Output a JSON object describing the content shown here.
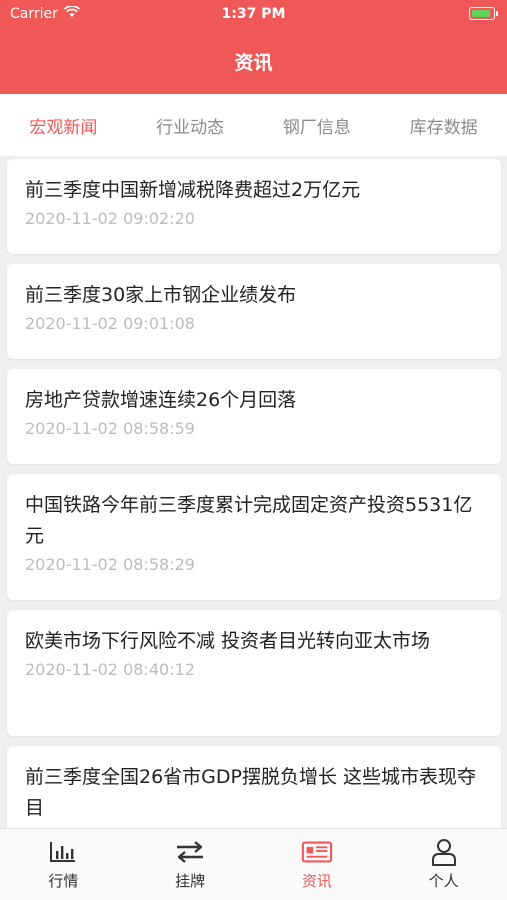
{
  "status": {
    "carrier": "Carrier",
    "time": "1:37 PM"
  },
  "header": {
    "title": "资讯"
  },
  "tabs": [
    {
      "label": "宏观新闻",
      "active": true
    },
    {
      "label": "行业动态",
      "active": false
    },
    {
      "label": "钢厂信息",
      "active": false
    },
    {
      "label": "库存数据",
      "active": false
    }
  ],
  "news": [
    {
      "title": "前三季度中国新增减税降费超过2万亿元",
      "time": "2020-11-02 09:02:20"
    },
    {
      "title": "前三季度30家上市钢企业绩发布",
      "time": "2020-11-02 09:01:08"
    },
    {
      "title": "房地产贷款增速连续26个月回落",
      "time": "2020-11-02 08:58:59"
    },
    {
      "title": "中国铁路今年前三季度累计完成固定资产投资5531亿元",
      "time": "2020-11-02 08:58:29"
    },
    {
      "title": "欧美市场下行风险不减 投资者目光转向亚太市场",
      "time": "2020-11-02 08:40:12"
    },
    {
      "title": "前三季度全国26省市GDP摆脱负增长 这些城市表现夺目",
      "time": ""
    }
  ],
  "tabbar": [
    {
      "label": "行情",
      "icon": "chart-icon",
      "active": false
    },
    {
      "label": "挂牌",
      "icon": "swap-icon",
      "active": false
    },
    {
      "label": "资讯",
      "icon": "newspaper-icon",
      "active": true
    },
    {
      "label": "个人",
      "icon": "person-icon",
      "active": false
    }
  ],
  "colors": {
    "brand": "#ef5857",
    "muted": "#8b8b8b",
    "time": "#bcbcbc"
  }
}
